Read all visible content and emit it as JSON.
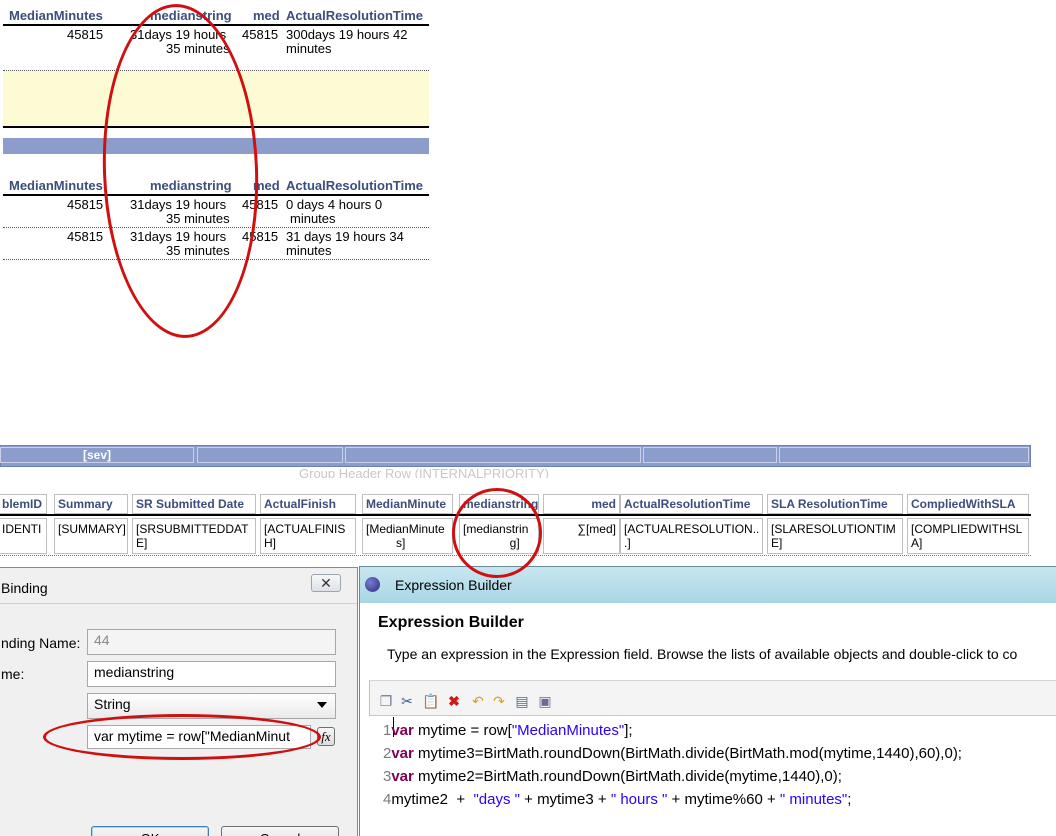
{
  "preview": {
    "headers": [
      "MedianMinutes",
      "medianstring",
      "med",
      "ActualResolutionTime"
    ],
    "group1_row": {
      "minutes": "45815",
      "string_l1": "31days 19 hours",
      "string_l2": "35 minutes",
      "med": "45815",
      "art_l1": "300days 19 hours  42",
      "art_l2": "minutes"
    },
    "group2_rows": [
      {
        "minutes": "45815",
        "string_l1": "31days 19 hours",
        "string_l2": "35 minutes",
        "med": "45815",
        "art_l1": "0  days 4  hours  0",
        "art_l2": "minutes"
      },
      {
        "minutes": "45815",
        "string_l1": "31days 19 hours",
        "string_l2": "35 minutes",
        "med": "45815",
        "art_l1": "31 days 19 hours  34",
        "art_l2": "minutes"
      }
    ]
  },
  "layout": {
    "sev_label": "[sev]",
    "group_header_text": "Group Header Row (INTERNALPRIORITY)",
    "columns": [
      {
        "header": "blemID",
        "cell": "IDENTI"
      },
      {
        "header": "Summary",
        "cell": "[SUMMARY]"
      },
      {
        "header": "SR Submitted Date",
        "cell": "[SRSUBMITTEDDAT\nE]"
      },
      {
        "header": "ActualFinish",
        "cell": "[ACTUALFINIS\nH]"
      },
      {
        "header": "MedianMinute",
        "cell": "[MedianMinute\n         s]"
      },
      {
        "header": "medianstring",
        "cell": "[medianstrin\n              g]"
      },
      {
        "header": "med",
        "cell": "∑[med]"
      },
      {
        "header": "ActualResolutionTime",
        "cell": "[ACTUALRESOLUTION..\n.]"
      },
      {
        "header": "SLA ResolutionTime",
        "cell": "[SLARESOLUTIONTIM\nE]"
      },
      {
        "header": "CompliedWithSLA",
        "cell": "[COMPLIEDWITHSL\nA]"
      }
    ]
  },
  "binding_dialog": {
    "title": "Binding",
    "binding_name_label": "nding Name:",
    "binding_name_value": "44",
    "name_label": "me:",
    "name_value": "medianstring",
    "data_type_value": "String",
    "expression_value": "var mytime = row[\"MedianMinut",
    "fx_label": "fx",
    "ok_label": "OK",
    "cancel_label": "Cancel"
  },
  "expression_builder": {
    "window_title": "Expression Builder",
    "heading": "Expression Builder",
    "description": "Type an expression in the Expression field. Browse the lists of available objects and double-click to co",
    "code_lines": [
      {
        "num": "1",
        "kw": "var",
        "text": " mytime = row[",
        "str": "\"MedianMinutes\"",
        "tail": "];"
      },
      {
        "num": "2",
        "kw": "var",
        "text": " mytime3=BirtMath.roundDown(BirtMath.divide(BirtMath.mod(mytime,1440),60),0);",
        "str": "",
        "tail": ""
      },
      {
        "num": "3",
        "kw": "var",
        "text": " mytime2=BirtMath.roundDown(BirtMath.divide(mytime,1440),0);",
        "str": "",
        "tail": ""
      }
    ],
    "line4": {
      "num": "4",
      "p1": "mytime2  +  ",
      "s1": "\"days \"",
      "p2": " + mytime3 + ",
      "s2": "\" hours \"",
      "p3": " + mytime%60 + ",
      "s3": "\" minutes\"",
      "p4": ";"
    }
  },
  "colors": {
    "accent": "#3c4e7c",
    "annotation": "#d01010",
    "group_band": "#8c9dcb",
    "yellow_band": "#fdfbd3"
  }
}
